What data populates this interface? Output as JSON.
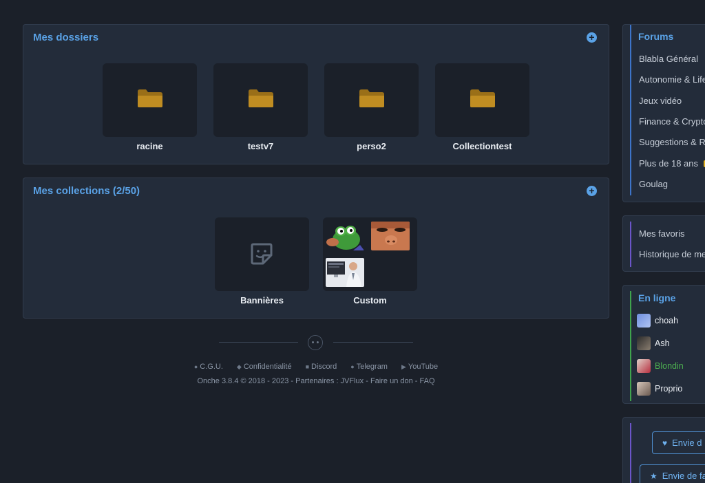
{
  "dossiers": {
    "title": "Mes dossiers",
    "add_label": "+",
    "items": [
      {
        "label": "racine"
      },
      {
        "label": "testv7"
      },
      {
        "label": "perso2"
      },
      {
        "label": "Collectiontest"
      }
    ]
  },
  "collections": {
    "title": "Mes collections (2/50)",
    "add_label": "+",
    "items": [
      {
        "label": "Bannières"
      },
      {
        "label": "Custom"
      }
    ]
  },
  "footer": {
    "links": [
      "C.G.U.",
      "Confidentialité",
      "Discord",
      "Telegram",
      "YouTube"
    ],
    "sub": "Onche 3.8.4 © 2018 - 2023 - Partenaires : JVFlux  - Faire un don  - FAQ"
  },
  "sidebar": {
    "forums_title": "Forums",
    "forums": [
      "Blabla Général",
      "Autonomie & Life",
      "Jeux vidéo",
      "Finance & Crypto",
      "Suggestions & R",
      "Plus de 18 ans",
      "Goulag"
    ],
    "personal": [
      "Mes favoris",
      "Historique de me"
    ],
    "online_title": "En ligne",
    "online": [
      {
        "name": "choah",
        "color": "#e8ecf1"
      },
      {
        "name": "Ash",
        "color": "#e8ecf1"
      },
      {
        "name": "Blondin",
        "color": "#4caf50"
      },
      {
        "name": "Proprio",
        "color": "#e8ecf1"
      }
    ],
    "buttons": [
      "Envie d",
      "Envie de fa"
    ]
  },
  "colors": {
    "accent": "#5aa2e6",
    "folder": "#b8861f",
    "background": "#1b2029",
    "panel": "#232c3a"
  }
}
